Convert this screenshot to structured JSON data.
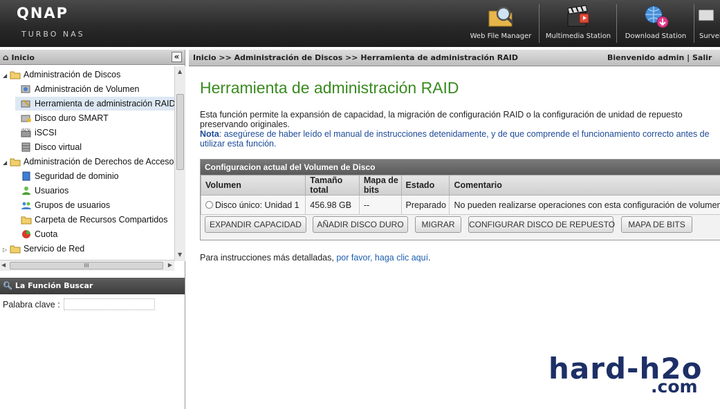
{
  "header": {
    "logo": "QNAP",
    "logo_sub": "TURBO NAS",
    "apps": [
      {
        "label": "Web File Manager",
        "icon": "folder-magnifier-icon"
      },
      {
        "label": "Multimedia Station",
        "icon": "film-clapper-icon"
      },
      {
        "label": "Download Station",
        "icon": "globe-download-icon"
      },
      {
        "label": "Survei",
        "icon": "camera-icon"
      }
    ]
  },
  "sidebar": {
    "title": "Inicio",
    "collapse_glyph": "«",
    "tree": [
      {
        "label": "Administración de Discos",
        "level": 0,
        "expanded": true,
        "icon": "folder-icon"
      },
      {
        "label": "Administración de Volumen",
        "level": 1,
        "icon": "disk-volume-icon"
      },
      {
        "label": "Herramienta de administración RAID",
        "level": 1,
        "selected": true,
        "icon": "raid-tool-icon"
      },
      {
        "label": "Disco duro SMART",
        "level": 1,
        "icon": "smart-disk-icon"
      },
      {
        "label": "iSCSI",
        "level": 1,
        "icon": "iscsi-icon"
      },
      {
        "label": "Disco virtual",
        "level": 1,
        "icon": "virtual-disk-icon"
      },
      {
        "label": "Administración de Derechos de Acceso",
        "level": 0,
        "expanded": true,
        "icon": "folder-icon"
      },
      {
        "label": "Seguridad de dominio",
        "level": 1,
        "icon": "domain-book-icon"
      },
      {
        "label": "Usuarios",
        "level": 1,
        "icon": "user-icon"
      },
      {
        "label": "Grupos de usuarios",
        "level": 1,
        "icon": "user-group-icon"
      },
      {
        "label": "Carpeta de Recursos Compartidos",
        "level": 1,
        "icon": "shared-folder-icon"
      },
      {
        "label": "Cuota",
        "level": 1,
        "icon": "quota-icon"
      },
      {
        "label": "Servicio de Red",
        "level": 0,
        "expanded": false,
        "icon": "folder-icon"
      }
    ],
    "hscroll_grip": "III",
    "search_title": "La Función Buscar",
    "search_label": "Palabra clave :",
    "search_value": ""
  },
  "topbar": {
    "breadcrumb": "Inicio >> Administración de Discos >> Herramienta de administración RAID",
    "welcome": "Bienvenido admin | Salir"
  },
  "main": {
    "title": "Herramienta de administración RAID",
    "description": "Esta función permite la expansión de capacidad, la migración de configuración RAID o la configuración de unidad de repuesto preservando originales.",
    "note_label": "Nota",
    "note_text": ": asegúrese de haber leído el manual de instrucciones detenidamente, y de que comprende el funcionamiento correcto antes de utilizar esta función.",
    "panel_title": "Configuracion actual del Volumen de Disco",
    "columns": [
      "Volumen",
      "Tamaño total",
      "Mapa de bits",
      "Estado",
      "Comentario"
    ],
    "rows": [
      {
        "volumen": "Disco único: Unidad 1",
        "tamano": "456.98 GB",
        "mapa": "--",
        "estado": "Preparado",
        "comentario": "No pueden realizarse operaciones con esta configuración de volumen."
      }
    ],
    "buttons": [
      "EXPANDIR CAPACIDAD",
      "AÑADIR DISCO DURO",
      "MIGRAR",
      "CONFIGURAR DISCO DE REPUESTO",
      "MAPA DE BITS"
    ],
    "instr_prefix": "Para instrucciones más detalladas, ",
    "instr_link": "por favor, haga clic aquí",
    "instr_suffix": "."
  },
  "watermark": {
    "main": "hard-h2o",
    "sub": ".com"
  },
  "colors": {
    "title_green": "#3a8a20",
    "note_blue": "#1d4a9a",
    "link_blue": "#1d5fb0",
    "watermark": "#1d2f66",
    "selected_row": "#dde8f4"
  }
}
